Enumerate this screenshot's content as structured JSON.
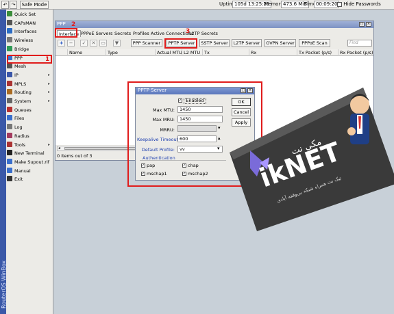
{
  "topbar": {
    "undo_icon": "undo-icon",
    "redo_icon": "redo-icon",
    "safe_mode_label": "Safe Mode",
    "uptime_label": "Uptime:",
    "uptime_value": "105d 13:25:29",
    "memory_label": "Memory:",
    "memory_value": "473.6 MiB",
    "time_label": "Time:",
    "time_value": "00:09:20",
    "hide_passwords_label": "Hide Passwords"
  },
  "sidebar": {
    "brand": "RouterOS WinBox",
    "items": [
      {
        "label": "Quick Set",
        "icon": "quick-set-icon",
        "color": "#3b8d3b"
      },
      {
        "label": "CAPsMAN",
        "icon": "capsman-icon",
        "color": "#555555"
      },
      {
        "label": "Interfaces",
        "icon": "interfaces-icon",
        "color": "#2b6cc4"
      },
      {
        "label": "Wireless",
        "icon": "wireless-icon",
        "color": "#777777"
      },
      {
        "label": "Bridge",
        "icon": "bridge-icon",
        "color": "#2f9a57"
      },
      {
        "label": "PPP",
        "icon": "ppp-icon",
        "color": "#3a6fcc"
      },
      {
        "label": "Mesh",
        "icon": "mesh-icon",
        "color": "#555555"
      },
      {
        "label": "IP",
        "icon": "ip-icon",
        "color": "#3a56a8"
      },
      {
        "label": "MPLS",
        "icon": "mpls-icon",
        "color": "#aa3333"
      },
      {
        "label": "Routing",
        "icon": "routing-icon",
        "color": "#aa6b22"
      },
      {
        "label": "System",
        "icon": "system-icon",
        "color": "#666666"
      },
      {
        "label": "Queues",
        "icon": "queues-icon",
        "color": "#b73030"
      },
      {
        "label": "Files",
        "icon": "files-icon",
        "color": "#3a6fcc"
      },
      {
        "label": "Log",
        "icon": "log-icon",
        "color": "#777777"
      },
      {
        "label": "Radius",
        "icon": "radius-icon",
        "color": "#a33b5e"
      },
      {
        "label": "Tools",
        "icon": "tools-icon",
        "color": "#aa3333"
      },
      {
        "label": "New Terminal",
        "icon": "terminal-icon",
        "color": "#222222"
      },
      {
        "label": "Make Supout.rif",
        "icon": "supout-icon",
        "color": "#3a6fcc"
      },
      {
        "label": "Manual",
        "icon": "manual-icon",
        "color": "#3a6fcc"
      },
      {
        "label": "Exit",
        "icon": "exit-icon",
        "color": "#333333"
      }
    ],
    "annotation": "1"
  },
  "ppp_window": {
    "title": "PPP",
    "tabs": [
      "Interface",
      "PPPoE Servers",
      "Secrets",
      "Profiles",
      "Active Connections",
      "L2TP Secrets"
    ],
    "tab_annotation": "2",
    "pptp_annotation": "3",
    "toolbar_buttons": [
      "PPP Scanner",
      "PPTP Server",
      "SSTP Server",
      "L2TP Server",
      "OVPN Server",
      "PPPoE Scan"
    ],
    "find_placeholder": "Find",
    "columns": [
      "Name",
      "Type",
      "Actual MTU",
      "L2 MTU",
      "Tx",
      "Rx",
      "Tx Packet (p/s)",
      "Rx Packet (p/s)"
    ],
    "status": "0 items out of 3"
  },
  "pptp_dialog": {
    "title": "PPTP Server",
    "enabled_label": "Enabled",
    "max_mtu_label": "Max MTU:",
    "max_mtu_value": "1450",
    "max_mru_label": "Max MRU:",
    "max_mru_value": "1450",
    "mrru_label": "MRRU:",
    "keepalive_label": "Keepalive Timeout:",
    "keepalive_value": "600",
    "default_profile_label": "Default Profile:",
    "default_profile_value": "vv",
    "authentication_label": "Authentication",
    "auth_options": [
      "pap",
      "chap",
      "mschap1",
      "mschap2"
    ],
    "ok_label": "OK",
    "cancel_label": "Cancel",
    "apply_label": "Apply"
  },
  "logo": {
    "brand_text": "ikNET",
    "persian_title": "مکی نت",
    "tagline": "تیک نت همراه شبکه بی‌وقفه آبادی"
  }
}
